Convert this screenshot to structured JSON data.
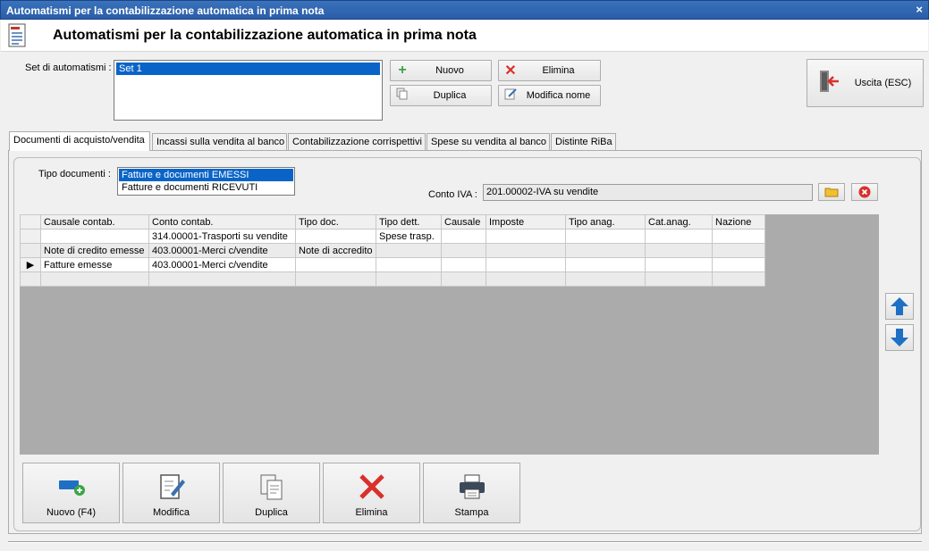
{
  "window": {
    "title": "Automatismi per la contabilizzazione automatica in prima nota",
    "close_glyph": "×"
  },
  "header": {
    "title": "Automatismi per la contabilizzazione automatica in prima nota",
    "icon": "document-icon"
  },
  "set": {
    "label": "Set di automatismi :",
    "items": [
      {
        "label": "Set 1",
        "selected": true
      }
    ]
  },
  "toolbar": {
    "nuovo": "Nuovo",
    "elimina": "Elimina",
    "duplica": "Duplica",
    "modifica_nome": "Modifica nome",
    "uscita": "Uscita (ESC)"
  },
  "tabs": [
    {
      "label": "Documenti di acquisto/vendita",
      "active": true
    },
    {
      "label": "Incassi sulla vendita al banco",
      "active": false
    },
    {
      "label": "Contabilizzazione corrispettivi",
      "active": false
    },
    {
      "label": "Spese su vendita al banco",
      "active": false
    },
    {
      "label": "Distinte RiBa",
      "active": false
    }
  ],
  "tipo_documenti": {
    "label": "Tipo documenti :",
    "items": [
      {
        "label": "Fatture e documenti EMESSI",
        "selected": true
      },
      {
        "label": "Fatture e documenti RICEVUTI",
        "selected": false
      }
    ]
  },
  "conto_iva": {
    "label": "Conto IVA :",
    "value": "201.00002-IVA su vendite"
  },
  "grid": {
    "columns": [
      "Causale contab.",
      "Conto contab.",
      "Tipo doc.",
      "Tipo dett.",
      "Causale",
      "Imposte",
      "Tipo anag.",
      "Cat.anag.",
      "Nazione"
    ],
    "rows": [
      [
        "",
        "314.00001-Trasporti su vendite",
        "",
        "Spese trasp.",
        "",
        "",
        "",
        "",
        ""
      ],
      [
        "Note di credito emesse",
        "403.00001-Merci c/vendite",
        "Note di accredito",
        "",
        "",
        "",
        "",
        "",
        ""
      ],
      [
        "Fatture emesse",
        "403.00001-Merci c/vendite",
        "",
        "",
        "",
        "",
        "",
        "",
        ""
      ],
      [
        "",
        "",
        "",
        "",
        "",
        "",
        "",
        "",
        ""
      ]
    ],
    "current_row_marker": "▶"
  },
  "bottom_buttons": {
    "nuovo": "Nuovo (F4)",
    "modifica": "Modifica",
    "duplica": "Duplica",
    "elimina": "Elimina",
    "stampa": "Stampa"
  },
  "colors": {
    "accent_blue": "#1f6fc5",
    "delete_red": "#d9302b",
    "add_green": "#3aa545",
    "selection": "#0a64c8"
  }
}
